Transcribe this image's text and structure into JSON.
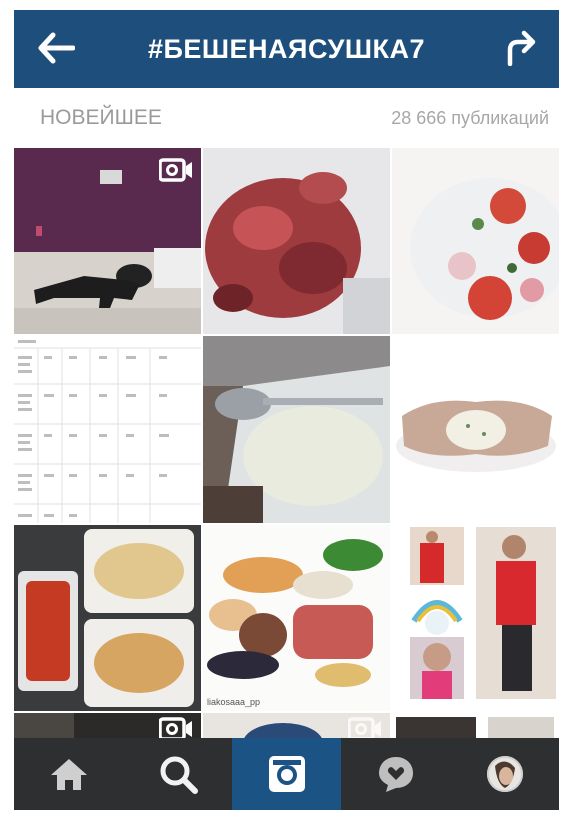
{
  "header": {
    "title": "#БЕШЕНАЯСУШКА7",
    "back_icon": "arrow-left-icon",
    "share_icon": "share-arrow-icon"
  },
  "subbar": {
    "sort_label": "НОВЕЙШЕЕ",
    "count_label": "28 666 публикаций"
  },
  "grid": {
    "watermark": "liakosaaa_pp"
  },
  "nav": {
    "items": [
      {
        "icon": "home-icon",
        "active": false
      },
      {
        "icon": "search-icon",
        "active": true
      },
      {
        "icon": "camera-icon",
        "active": false
      },
      {
        "icon": "activity-bubble-icon",
        "active": false
      },
      {
        "icon": "profile-avatar-icon",
        "active": false
      }
    ]
  },
  "colors": {
    "header_bg": "#1e4e7b",
    "nav_bg": "#2e2f31",
    "nav_active_bg": "#1b5385"
  }
}
